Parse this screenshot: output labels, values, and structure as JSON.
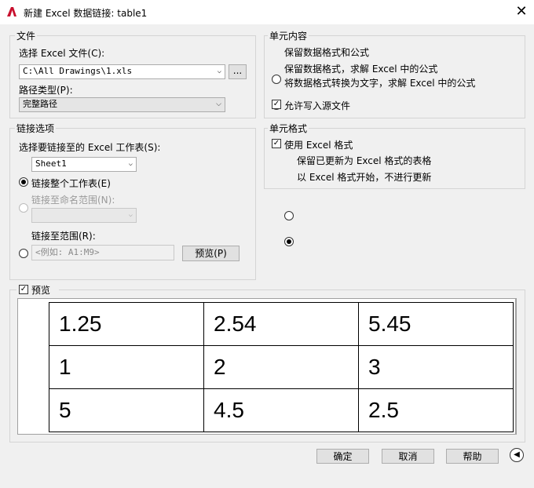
{
  "window": {
    "title": "新建 Excel 数据链接: table1",
    "close_glyph": "✕"
  },
  "file_group": {
    "legend": "文件",
    "select_label": "选择 Excel 文件(C):",
    "file_value": "C:\\All Drawings\\1.xls",
    "browse_label": "...",
    "path_type_label": "路径类型(P):",
    "path_type_value": "完整路径"
  },
  "link_group": {
    "legend": "链接选项",
    "sheet_label": "选择要链接至的 Excel 工作表(S):",
    "sheet_value": "Sheet1",
    "opt_whole_sheet": "链接整个工作表(E)",
    "opt_named_range": "链接至命名范围(N):",
    "opt_range": "链接至范围(R):",
    "range_placeholder": "<例如: A1:M9>",
    "preview_button": "预览(P)"
  },
  "cell_content": {
    "legend": "单元内容",
    "opt1": "保留数据格式和公式",
    "opt2": "保留数据格式，求解 Excel 中的公式",
    "opt3": "将数据格式转换为文字，求解 Excel 中的公式",
    "allow_write": "允许写入源文件"
  },
  "cell_format": {
    "legend": "单元格式",
    "use_excel_format": "使用 Excel 格式",
    "opt_keep_updated": "保留已更新为 Excel 格式的表格",
    "opt_start_no_update": "以 Excel 格式开始，不进行更新"
  },
  "preview": {
    "label": "预览",
    "rows": [
      [
        "1.25",
        "2.54",
        "5.45"
      ],
      [
        "1",
        "2",
        "3"
      ],
      [
        "5",
        "4.5",
        "2.5"
      ]
    ]
  },
  "footer": {
    "ok": "确定",
    "cancel": "取消",
    "help": "帮助",
    "expand_glyph": "◀"
  },
  "colors": {
    "logo_red": "#c8102e",
    "window_bg": "#f0f0f0"
  }
}
